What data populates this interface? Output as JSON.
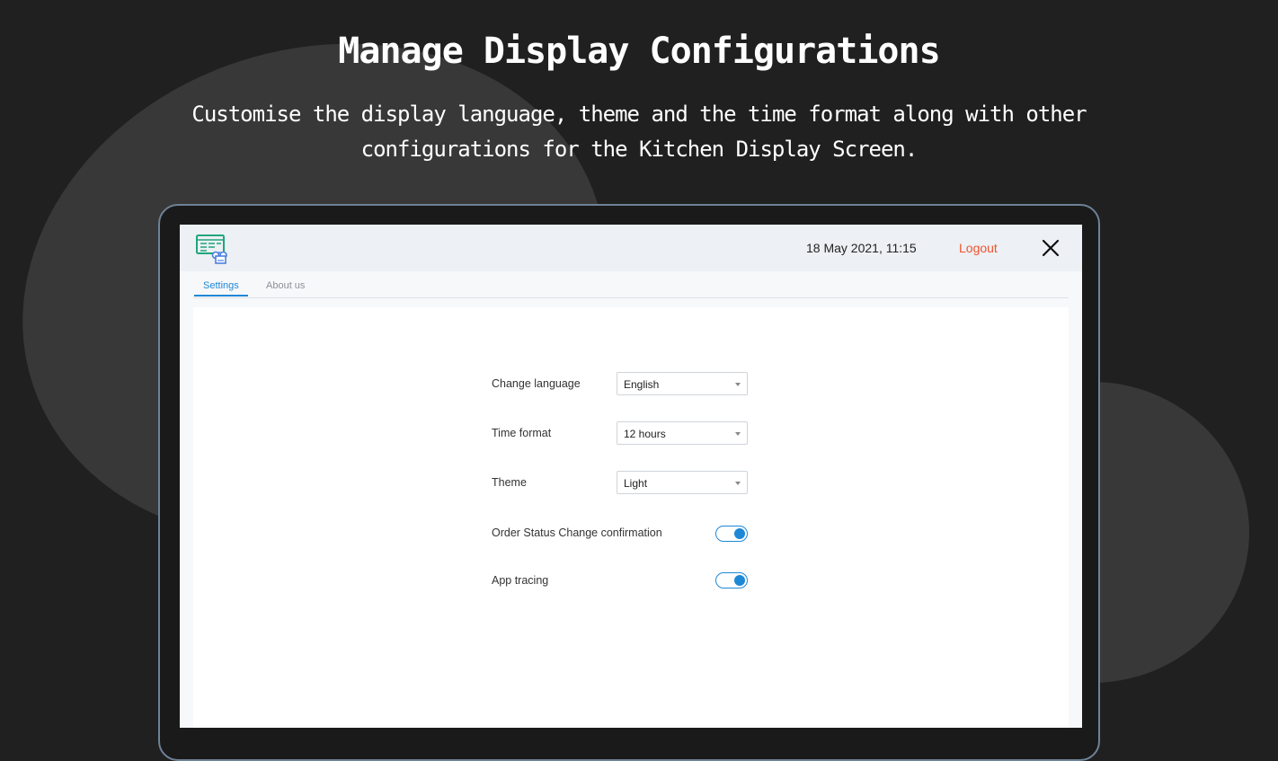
{
  "hero": {
    "title": "Manage Display Configurations",
    "subtitle": "Customise the display language, theme and the time format along with other configurations for the Kitchen Display Screen."
  },
  "header": {
    "logo_icon": "kitchen-display-chef-icon",
    "datetime": "18 May 2021, 11:15",
    "logout_label": "Logout",
    "close_icon": "close-icon"
  },
  "tabs": [
    {
      "label": "Settings",
      "active": true
    },
    {
      "label": "About us",
      "active": false
    }
  ],
  "settings": {
    "language": {
      "label": "Change language",
      "value": "English"
    },
    "time_format": {
      "label": "Time format",
      "value": "12 hours"
    },
    "theme": {
      "label": "Theme",
      "value": "Light"
    },
    "order_status_confirmation": {
      "label": "Order Status Change confirmation",
      "enabled": true
    },
    "app_tracing": {
      "label": "App tracing",
      "enabled": true
    }
  },
  "colors": {
    "accent": "#1e88d6",
    "logout": "#f0532f",
    "logo_green": "#1fa67a",
    "logo_blue": "#4a7fe0",
    "background": "#202020"
  }
}
